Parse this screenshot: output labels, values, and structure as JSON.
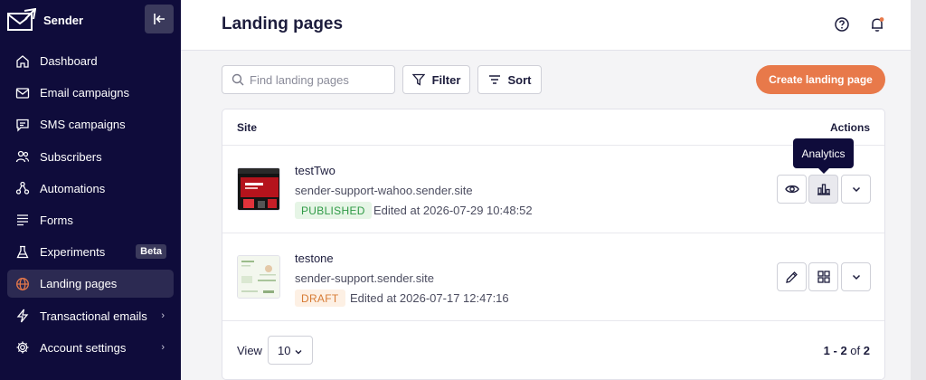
{
  "app": {
    "name": "Sender"
  },
  "sidebar": {
    "items": [
      {
        "label": "Dashboard",
        "icon": "home-icon"
      },
      {
        "label": "Email campaigns",
        "icon": "mail-icon"
      },
      {
        "label": "SMS campaigns",
        "icon": "chat-icon"
      },
      {
        "label": "Subscribers",
        "icon": "users-icon"
      },
      {
        "label": "Automations",
        "icon": "automation-icon"
      },
      {
        "label": "Forms",
        "icon": "forms-icon"
      },
      {
        "label": "Experiments",
        "icon": "flask-icon",
        "badge": "Beta"
      },
      {
        "label": "Landing pages",
        "icon": "globe-icon",
        "active": true
      },
      {
        "label": "Transactional emails",
        "icon": "lightning-icon",
        "chevron": true
      },
      {
        "label": "Account settings",
        "icon": "gear-icon",
        "chevron": true
      }
    ]
  },
  "header": {
    "title": "Landing pages"
  },
  "toolbar": {
    "search_placeholder": "Find landing pages",
    "filter_label": "Filter",
    "sort_label": "Sort",
    "create_label": "Create landing page"
  },
  "table": {
    "col_site": "Site",
    "col_actions": "Actions",
    "rows": [
      {
        "name": "testTwo",
        "url": "sender-support-wahoo.sender.site",
        "status": "PUBLISHED",
        "edited": "Edited at 2026-07-29 10:48:52"
      },
      {
        "name": "testone",
        "url": "sender-support.sender.site",
        "status": "DRAFT",
        "edited": "Edited at 2026-07-17 12:47:16"
      }
    ]
  },
  "tooltip": {
    "label": "Analytics"
  },
  "footer": {
    "view_label": "View",
    "view_value": "10",
    "range": "1 - 2",
    "of": "of",
    "total": "2"
  },
  "colors": {
    "sidebar": "#0f0c3b",
    "accent": "#e8794a",
    "published": "#2f9a46",
    "draft": "#d77b35"
  }
}
